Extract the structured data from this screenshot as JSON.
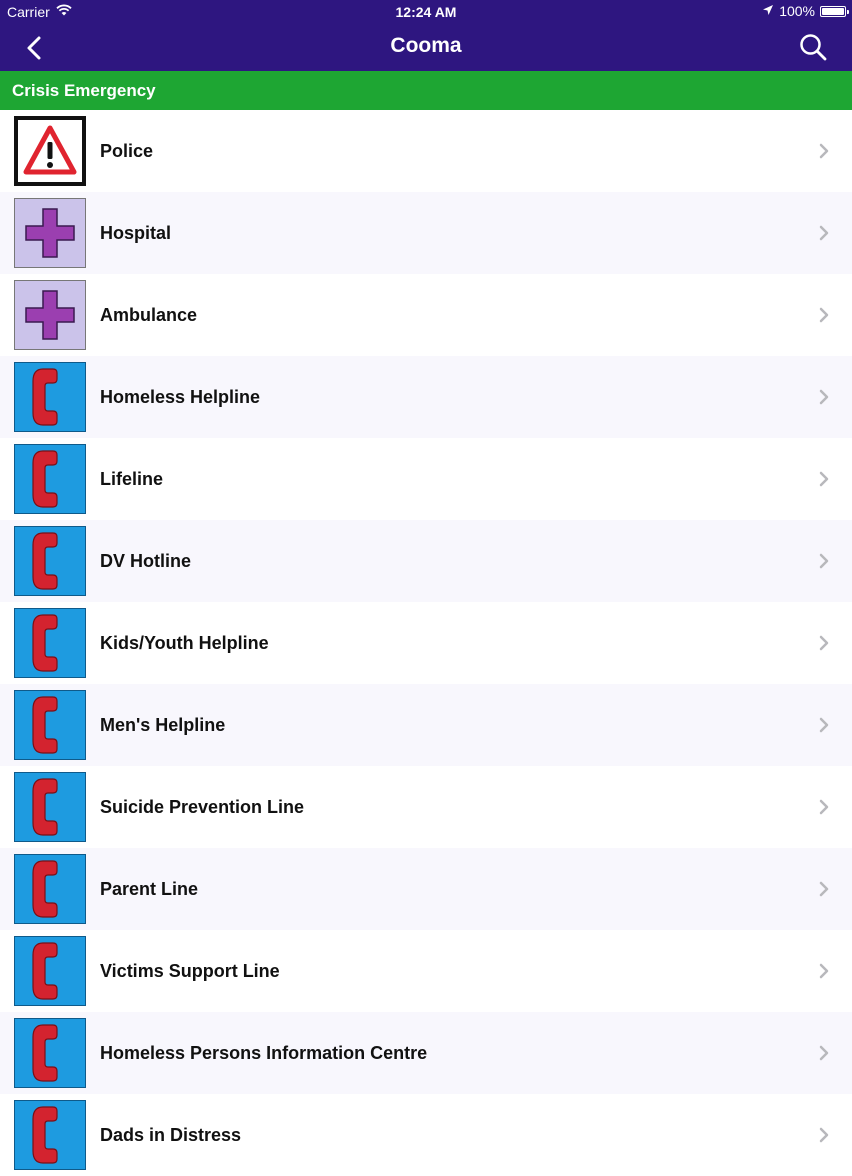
{
  "status_bar": {
    "carrier": "Carrier",
    "time": "12:24 AM",
    "battery": "100%"
  },
  "nav": {
    "title": "Cooma",
    "back_icon": "chevron-left-icon",
    "search_icon": "search-icon"
  },
  "section": {
    "title": "Crisis Emergency"
  },
  "colors": {
    "nav_bg": "#2e1680",
    "section_bg": "#1ea633",
    "phone_icon_bg": "#1e9be0",
    "phone_handset": "#d3232f",
    "cross_color": "#9b3fb0"
  },
  "items": [
    {
      "label": "Police",
      "icon": "warning-icon"
    },
    {
      "label": "Hospital",
      "icon": "medical-cross-icon"
    },
    {
      "label": "Ambulance",
      "icon": "medical-cross-icon"
    },
    {
      "label": "Homeless Helpline",
      "icon": "phone-icon"
    },
    {
      "label": "Lifeline",
      "icon": "phone-icon"
    },
    {
      "label": "DV Hotline",
      "icon": "phone-icon"
    },
    {
      "label": "Kids/Youth Helpline",
      "icon": "phone-icon"
    },
    {
      "label": "Men's Helpline",
      "icon": "phone-icon"
    },
    {
      "label": "Suicide Prevention Line",
      "icon": "phone-icon"
    },
    {
      "label": "Parent Line",
      "icon": "phone-icon"
    },
    {
      "label": "Victims Support Line",
      "icon": "phone-icon"
    },
    {
      "label": "Homeless Persons Information Centre",
      "icon": "phone-icon"
    },
    {
      "label": "Dads in Distress",
      "icon": "phone-icon"
    }
  ]
}
